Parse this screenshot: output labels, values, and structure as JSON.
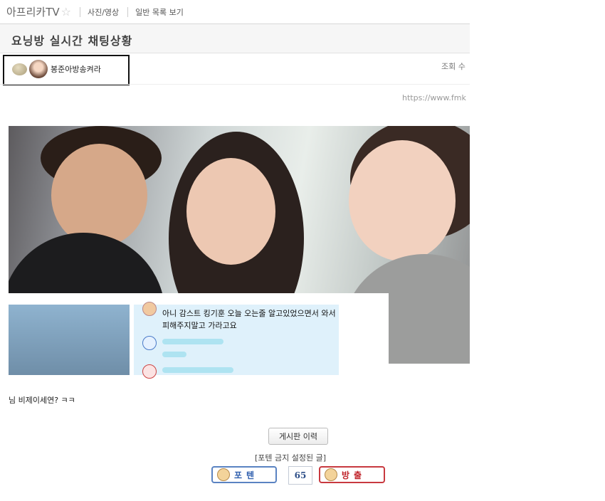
{
  "header": {
    "board_name": "아프리카TV",
    "nav_links": [
      "사진/영상",
      "일반 목록 보기"
    ]
  },
  "post": {
    "title": "요닝방 실시간 채팅상황",
    "author": "봉준아방송켜라",
    "views_label": "조회 수",
    "source_url": "https://www.fmk",
    "chat_text": "아니 감스트 킹기훈 오늘 오는줄 알고있었으면서 와서 피해주지말고 가라고요",
    "caption": "님 비제이세연? ㅋㅋ"
  },
  "footer": {
    "history_button": "게시판 이력",
    "notice": "[포텐 금지 설정된 글]",
    "upvote_label": "포텐",
    "vote_count": "65",
    "downvote_label": "방출"
  },
  "icons": {
    "star": "star-icon",
    "level": "member-level-icon",
    "avatar": "avatar",
    "upvote": "smile-face-icon",
    "downvote": "angry-face-icon"
  }
}
